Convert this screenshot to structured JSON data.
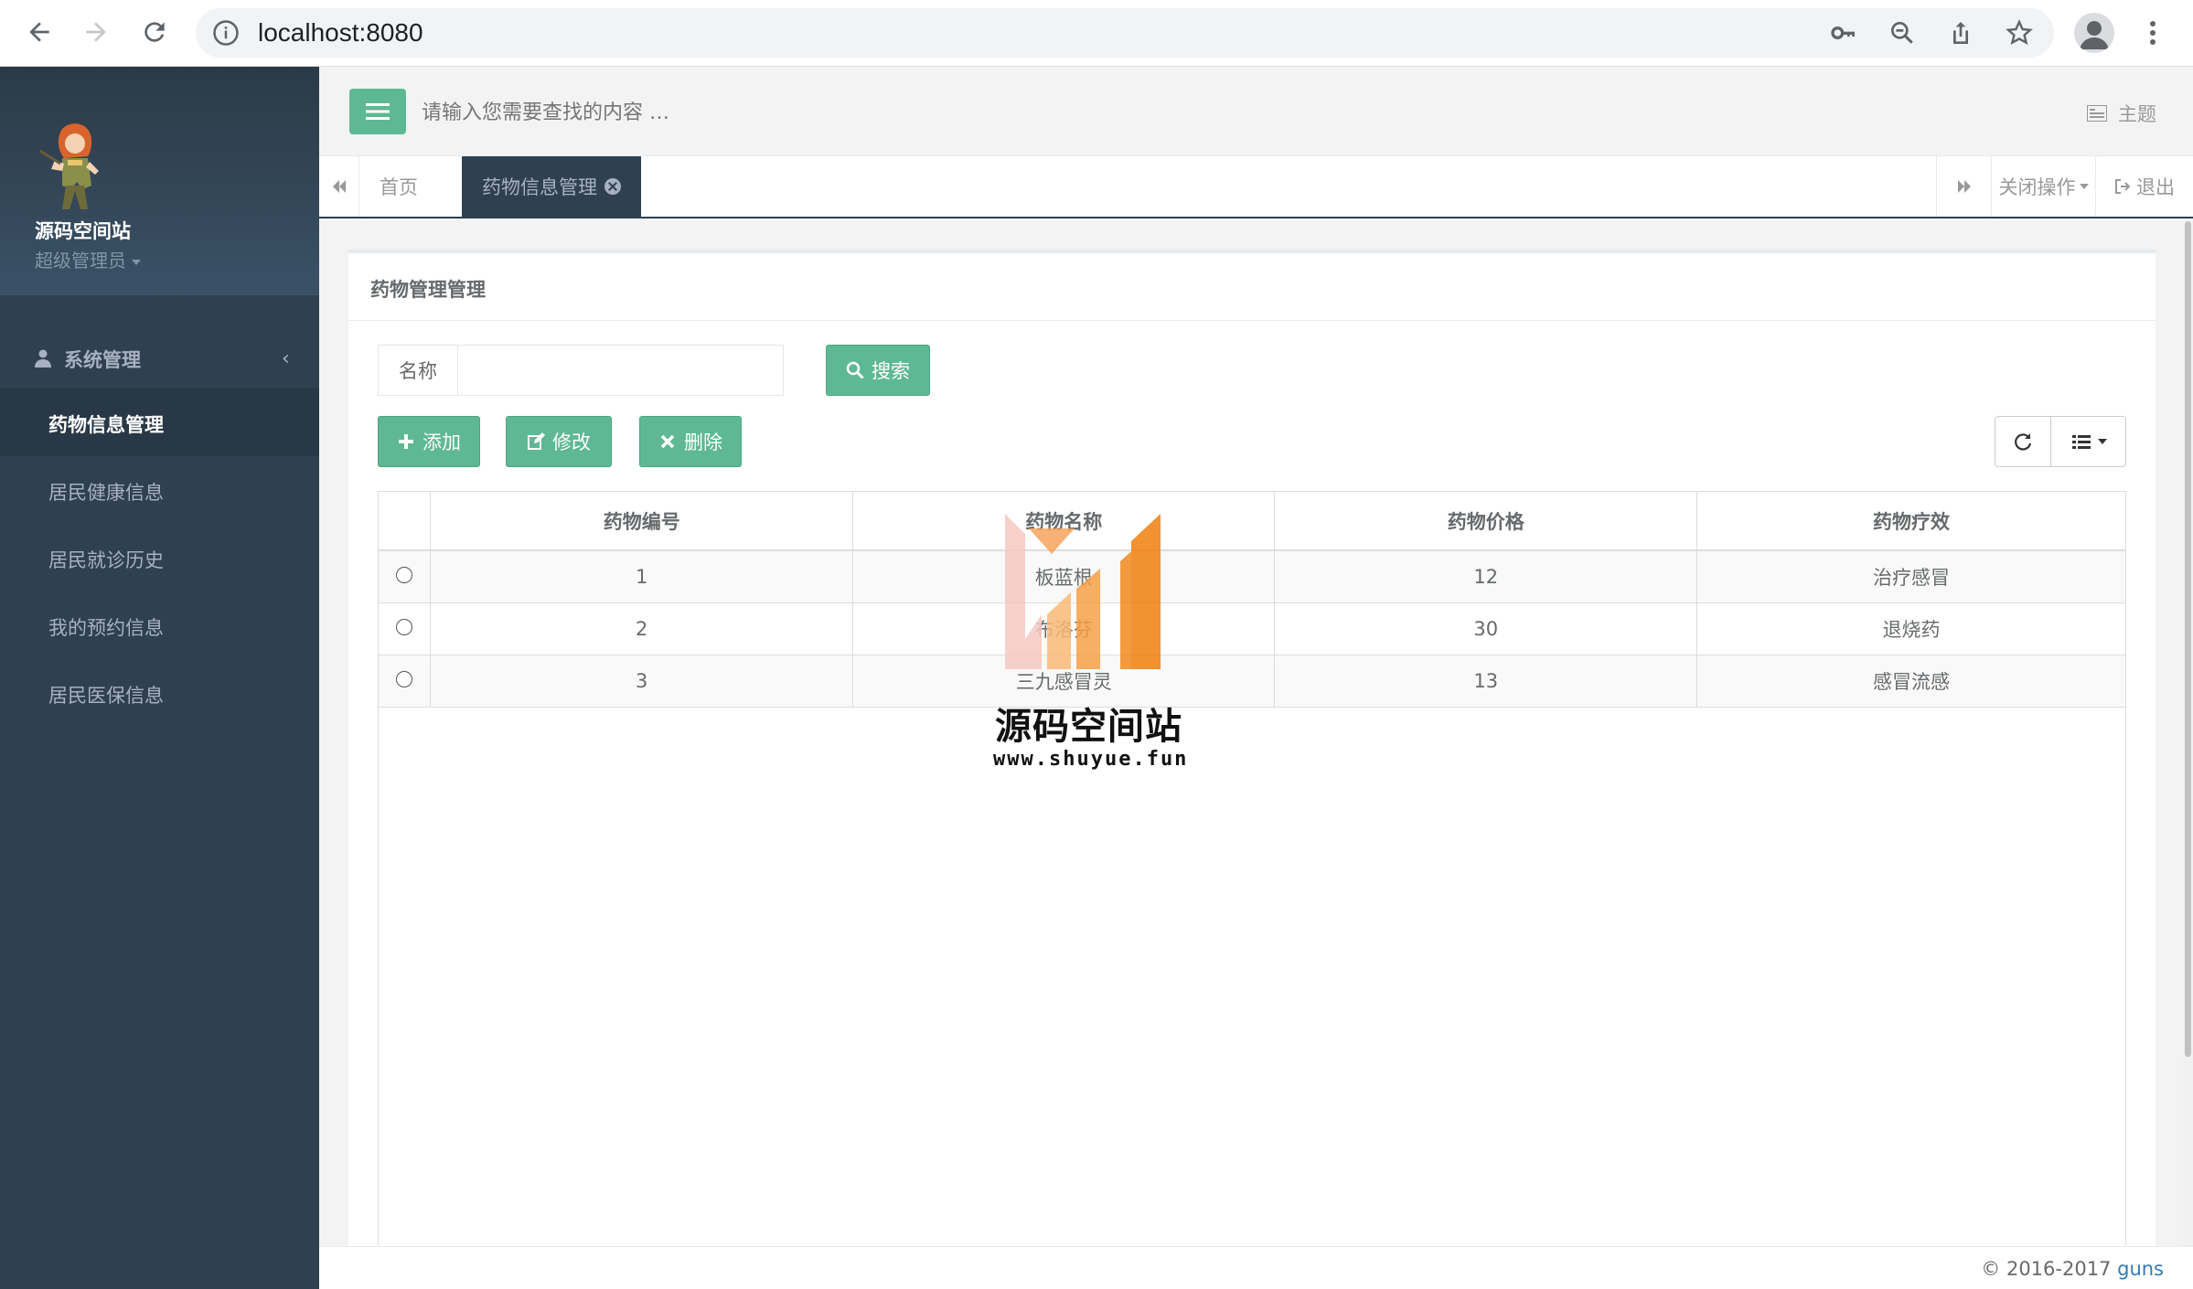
{
  "browser": {
    "url": "localhost:8080"
  },
  "sidebar": {
    "site_name": "源码空间站",
    "role": "超级管理员",
    "parent_label": "系统管理",
    "items": [
      {
        "label": "药物信息管理",
        "active": true
      },
      {
        "label": "居民健康信息",
        "active": false
      },
      {
        "label": "居民就诊历史",
        "active": false
      },
      {
        "label": "我的预约信息",
        "active": false
      },
      {
        "label": "居民医保信息",
        "active": false
      }
    ]
  },
  "header": {
    "search_placeholder": "请输入您需要查找的内容 …",
    "theme_label": "主题"
  },
  "tabs": {
    "home": "首页",
    "active": "药物信息管理",
    "close_ops": "关闭操作",
    "logout": "退出"
  },
  "panel": {
    "title": "药物管理管理",
    "search_label": "名称",
    "search_button": "搜索",
    "add_button": "添加",
    "edit_button": "修改",
    "delete_button": "删除"
  },
  "table": {
    "columns": [
      "药物编号",
      "药物名称",
      "药物价格",
      "药物疗效"
    ],
    "rows": [
      {
        "id": "1",
        "name": "板蓝根",
        "price": "12",
        "effect": "治疗感冒"
      },
      {
        "id": "2",
        "name": "布洛芬",
        "price": "30",
        "effect": "退烧药"
      },
      {
        "id": "3",
        "name": "三九感冒灵",
        "price": "13",
        "effect": "感冒流感"
      }
    ]
  },
  "watermark": {
    "name": "源码空间站",
    "url": "www.shuyue.fun"
  },
  "footer": {
    "copyright": "© 2016-2017 ",
    "link": "guns"
  },
  "colors": {
    "sidebar_bg": "#2f4050",
    "accent_green": "#5fb894",
    "link_blue": "#337ab7"
  }
}
